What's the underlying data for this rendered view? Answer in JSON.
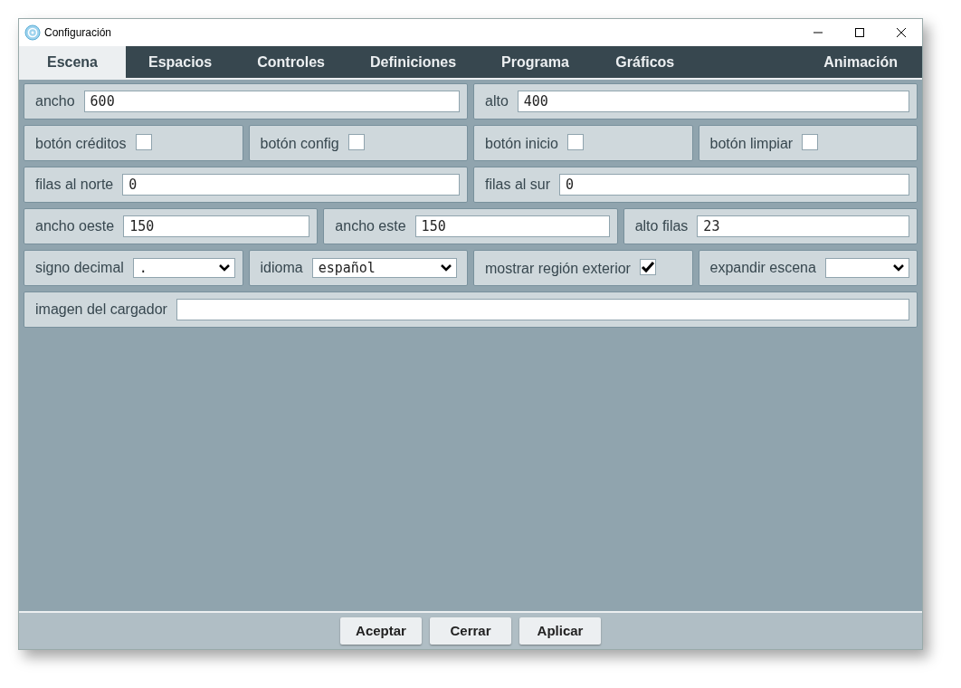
{
  "window": {
    "title": "Configuración"
  },
  "tabs": [
    {
      "label": "Escena",
      "selected": true
    },
    {
      "label": "Espacios",
      "selected": false
    },
    {
      "label": "Controles",
      "selected": false
    },
    {
      "label": "Definiciones",
      "selected": false
    },
    {
      "label": "Programa",
      "selected": false
    },
    {
      "label": "Gráficos",
      "selected": false
    },
    {
      "label": "Animación",
      "selected": false
    }
  ],
  "rows": [
    [
      {
        "kind": "text",
        "label": "ancho",
        "value": "600"
      },
      {
        "kind": "text",
        "label": "alto",
        "value": "400"
      }
    ],
    [
      {
        "kind": "checkbox",
        "label": "botón créditos",
        "checked": false
      },
      {
        "kind": "checkbox",
        "label": "botón config",
        "checked": false
      },
      {
        "kind": "checkbox",
        "label": "botón inicio",
        "checked": false
      },
      {
        "kind": "checkbox",
        "label": "botón limpiar",
        "checked": false
      }
    ],
    [
      {
        "kind": "text",
        "label": "filas al norte",
        "value": "0"
      },
      {
        "kind": "text",
        "label": "filas al sur",
        "value": "0"
      }
    ],
    [
      {
        "kind": "text",
        "label": "ancho oeste",
        "value": "150"
      },
      {
        "kind": "text",
        "label": "ancho este",
        "value": "150"
      },
      {
        "kind": "text",
        "label": "alto filas",
        "value": "23"
      }
    ],
    [
      {
        "kind": "select",
        "label": "signo decimal",
        "value": "."
      },
      {
        "kind": "select",
        "label": "idioma",
        "value": "español"
      },
      {
        "kind": "checkbox",
        "label": "mostrar región exterior",
        "checked": true
      },
      {
        "kind": "select",
        "label": "expandir escena"
      }
    ],
    [
      {
        "kind": "text",
        "label": "imagen del cargador"
      }
    ]
  ],
  "buttons": [
    "Aceptar",
    "Cerrar",
    "Aplicar"
  ]
}
